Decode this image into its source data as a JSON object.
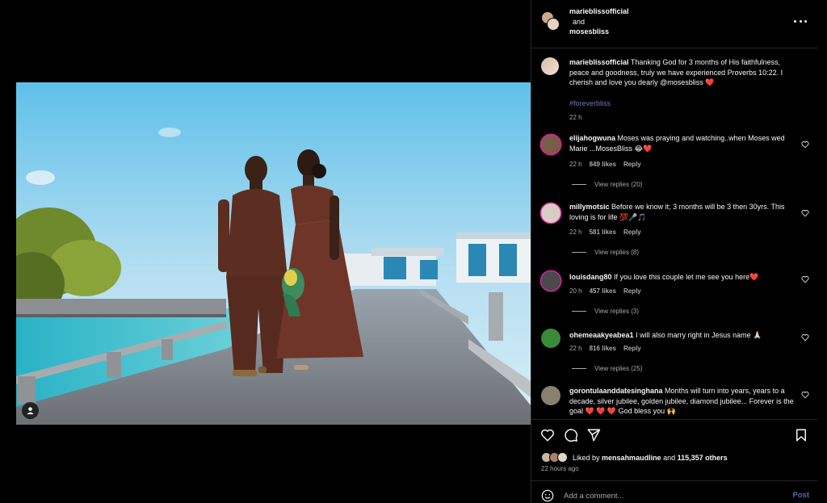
{
  "header": {
    "user1": "marieblissofficial",
    "conjunction": "and",
    "user2": "mosesbliss",
    "more_icon": "more-horizontal-icon"
  },
  "caption": {
    "user": "marieblissofficial",
    "text": "Thanking God for 3 months of His faithfulness, peace and goodness, truly we have experienced Proverbs 10:22. I cherish and love you dearly @mosesbliss ❤️",
    "hashtag": "#foreverbliss",
    "time": "22 h"
  },
  "comments": [
    {
      "user": "elijahogwuna",
      "text": "Moses was praying and watching..when Moses wed Marie ...MosesBliss 😂❤️",
      "time": "22 h",
      "likes": "849 likes",
      "reply": "Reply",
      "view_replies": "View replies (20)"
    },
    {
      "user": "millymotsic",
      "text": "Before we know it; 3 months will be 3 then 30yrs. This loving is for life 💯🎤🎵",
      "time": "22 h",
      "likes": "581 likes",
      "reply": "Reply",
      "view_replies": "View replies (8)"
    },
    {
      "user": "louisdang80",
      "text": "If you love this couple let me see you here❤️",
      "time": "20 h",
      "likes": "457 likes",
      "reply": "Reply",
      "view_replies": "View replies (3)"
    },
    {
      "user": "ohemeaakyeabea1",
      "text": "I will also marry right in Jesus name 🙏🏻",
      "time": "22 h",
      "likes": "816 likes",
      "reply": "Reply",
      "view_replies": "View replies (25)"
    },
    {
      "user": "gorontulaanddatesinghana",
      "text": "Months will turn into years, years to a decade, silver jubilee, golden jubilee, diamond jubilee... Forever is the goal ❤️ ❤️ ❤️ God bless you 🙌",
      "time": "",
      "likes": "",
      "reply": "",
      "view_replies": ""
    }
  ],
  "actions": {
    "liked_by_prefix": "Liked by",
    "liked_by_user": "mensahmaudline",
    "liked_by_and": "and",
    "others": "115,357 others",
    "time_ago": "22 hours ago"
  },
  "add_comment": {
    "placeholder": "Add a comment...",
    "post_label": "Post"
  },
  "colors": {
    "background": "#000000",
    "text": "#f5f5f5",
    "muted": "#a8a8a8",
    "link": "#4a6fb3",
    "hashtag": "#6d7ab8",
    "heart": "#ed4956",
    "divider": "#262626"
  }
}
